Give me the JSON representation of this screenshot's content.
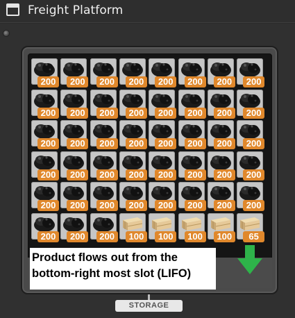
{
  "window": {
    "title": "Freight Platform",
    "icon": "window-icon"
  },
  "inventory": {
    "columns": 8,
    "rows": [
      [
        {
          "item": "coal",
          "qty": "200"
        },
        {
          "item": "coal",
          "qty": "200"
        },
        {
          "item": "coal",
          "qty": "200"
        },
        {
          "item": "coal",
          "qty": "200"
        },
        {
          "item": "coal",
          "qty": "200"
        },
        {
          "item": "coal",
          "qty": "200"
        },
        {
          "item": "coal",
          "qty": "200"
        },
        {
          "item": "coal",
          "qty": "200"
        }
      ],
      [
        {
          "item": "coal",
          "qty": "200"
        },
        {
          "item": "coal",
          "qty": "200"
        },
        {
          "item": "coal",
          "qty": "200"
        },
        {
          "item": "coal",
          "qty": "200"
        },
        {
          "item": "coal",
          "qty": "200"
        },
        {
          "item": "coal",
          "qty": "200"
        },
        {
          "item": "coal",
          "qty": "200"
        },
        {
          "item": "coal",
          "qty": "200"
        }
      ],
      [
        {
          "item": "coal",
          "qty": "200"
        },
        {
          "item": "coal",
          "qty": "200"
        },
        {
          "item": "coal",
          "qty": "200"
        },
        {
          "item": "coal",
          "qty": "200"
        },
        {
          "item": "coal",
          "qty": "200"
        },
        {
          "item": "coal",
          "qty": "200"
        },
        {
          "item": "coal",
          "qty": "200"
        },
        {
          "item": "coal",
          "qty": "200"
        }
      ],
      [
        {
          "item": "coal",
          "qty": "200"
        },
        {
          "item": "coal",
          "qty": "200"
        },
        {
          "item": "coal",
          "qty": "200"
        },
        {
          "item": "coal",
          "qty": "200"
        },
        {
          "item": "coal",
          "qty": "200"
        },
        {
          "item": "coal",
          "qty": "200"
        },
        {
          "item": "coal",
          "qty": "200"
        },
        {
          "item": "coal",
          "qty": "200"
        }
      ],
      [
        {
          "item": "coal",
          "qty": "200"
        },
        {
          "item": "coal",
          "qty": "200"
        },
        {
          "item": "coal",
          "qty": "200"
        },
        {
          "item": "coal",
          "qty": "200"
        },
        {
          "item": "coal",
          "qty": "200"
        },
        {
          "item": "coal",
          "qty": "200"
        },
        {
          "item": "coal",
          "qty": "200"
        },
        {
          "item": "coal",
          "qty": "200"
        }
      ],
      [
        {
          "item": "coal",
          "qty": "200"
        },
        {
          "item": "coal",
          "qty": "200"
        },
        {
          "item": "coal",
          "qty": "200"
        },
        {
          "item": "planks",
          "qty": "100"
        },
        {
          "item": "planks",
          "qty": "100"
        },
        {
          "item": "planks",
          "qty": "100"
        },
        {
          "item": "planks",
          "qty": "100"
        },
        {
          "item": "planks",
          "qty": "65"
        }
      ]
    ]
  },
  "note": {
    "text": "Product flows out from the bottom-right most slot (LIFO)"
  },
  "output_arrow": {
    "icon": "arrow-down-icon",
    "color": "#2eb34a"
  },
  "storage_tab": {
    "label": "STORAGE"
  },
  "colors": {
    "qty_badge": "#e0882c",
    "slot": "#c6c6c6",
    "panel": "#151515"
  }
}
